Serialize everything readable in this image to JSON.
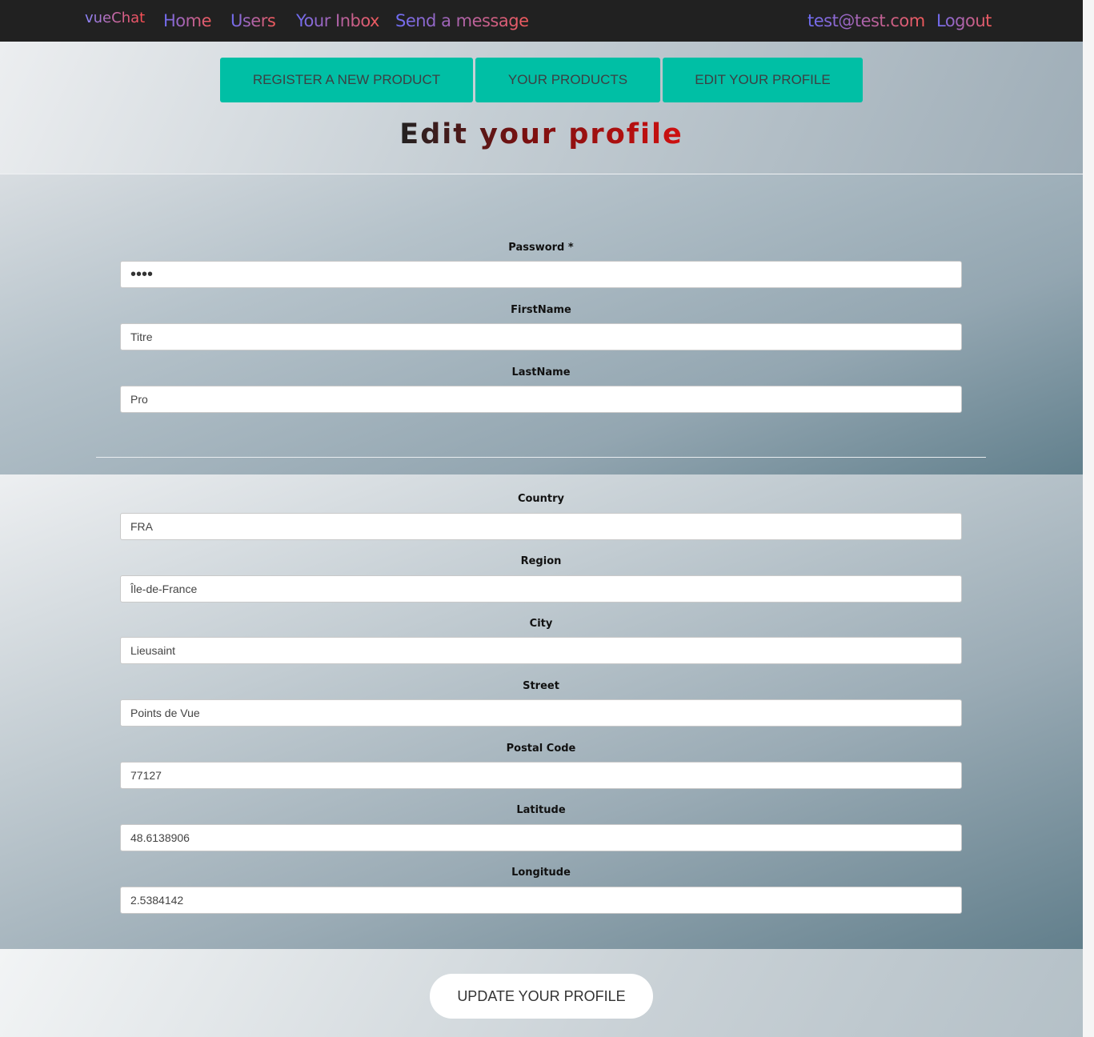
{
  "navbar": {
    "brand": "vueChat",
    "links": [
      "Home",
      "Users",
      "Your Inbox",
      "Send a message"
    ],
    "user_email": "test@test.com",
    "logout": "Logout"
  },
  "tabs": [
    "REGISTER A NEW PRODUCT",
    "YOUR PRODUCTS",
    "EDIT YOUR PROFILE"
  ],
  "page_title": "Edit your profile",
  "account_fields": [
    {
      "label": "Password *",
      "value": "••••"
    },
    {
      "label": "FirstName",
      "value": "Titre"
    },
    {
      "label": "LastName",
      "value": "Pro"
    }
  ],
  "address_fields": [
    {
      "label": "Country",
      "value": "FRA"
    },
    {
      "label": "Region",
      "value": "Île-de-France"
    },
    {
      "label": "City",
      "value": "Lieusaint"
    },
    {
      "label": "Street",
      "value": "Points de Vue"
    },
    {
      "label": "Postal Code",
      "value": "77127"
    },
    {
      "label": "Latitude",
      "value": "48.6138906"
    },
    {
      "label": "Longitude",
      "value": "2.5384142"
    }
  ],
  "update_button": "UPDATE YOUR PROFILE",
  "colors": {
    "navbar": "#212121",
    "tab_button": "#00bfa5",
    "title_dark": "#222222",
    "title_red": "#d01010"
  }
}
